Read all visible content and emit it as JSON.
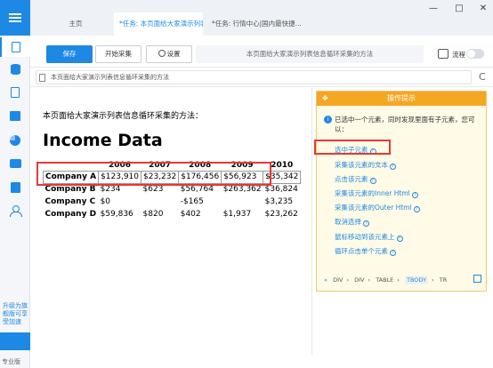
{
  "window": {
    "tabs": [
      {
        "label": "主页"
      },
      {
        "label": "*任务: 本页面给大家演示列表..."
      },
      {
        "label": "*任务: 行情中心|国内最快捷..."
      }
    ],
    "tab_close": "×",
    "controls": {
      "minimize": "—",
      "maximize": "□",
      "close": "✕"
    }
  },
  "sidebar": {
    "upgrade_text": "升级为旗舰版可享受加速",
    "footer": "专业版"
  },
  "toolbar": {
    "save_label": "保存",
    "start_label": "开始采集",
    "settings_label": "设置",
    "task_title": "本页面给大家演示列表信息循环采集的方法",
    "flow_label": "流程"
  },
  "urlbar": {
    "url": "本页面给大家演示列表信息循环采集的方法",
    "refresh": "C"
  },
  "page": {
    "intro": "本页面给大家演示列表信息循环采集的方法：",
    "heading": "Income Data",
    "table": {
      "headers": [
        "",
        "2006",
        "2007",
        "2008",
        "2009",
        "2010"
      ],
      "rows": [
        [
          "Company A",
          "$123,910",
          "$23,232",
          "$176,456",
          "$56,923",
          "$35,342"
        ],
        [
          "Company B",
          "$234",
          "$623",
          "$56,764",
          "$263,362",
          "$36,824"
        ],
        [
          "Company C",
          "$0",
          "",
          "-$165",
          "",
          "$3,235"
        ],
        [
          "Company D",
          "$59,836",
          "$820",
          "$402",
          "$1,937",
          "$23,262"
        ]
      ]
    }
  },
  "panel": {
    "title": "操作提示",
    "message": "已选中一个元素，同时发现里面有子元素，您可以：",
    "options": [
      "选中子元素",
      "采集该元素的文本",
      "点击该元素",
      "采集该元素的Inner Html",
      "采集该元素的Outer Html",
      "取消选择",
      "鼠标移动到该元素上",
      "循环点击单个元素"
    ],
    "breadcrumbs": [
      "DIV",
      "DIV",
      "TABLE",
      "TBODY",
      "TR"
    ]
  },
  "colors": {
    "accent": "#1e88e5",
    "panel_header": "#f5a623",
    "highlight": "#e53935"
  }
}
